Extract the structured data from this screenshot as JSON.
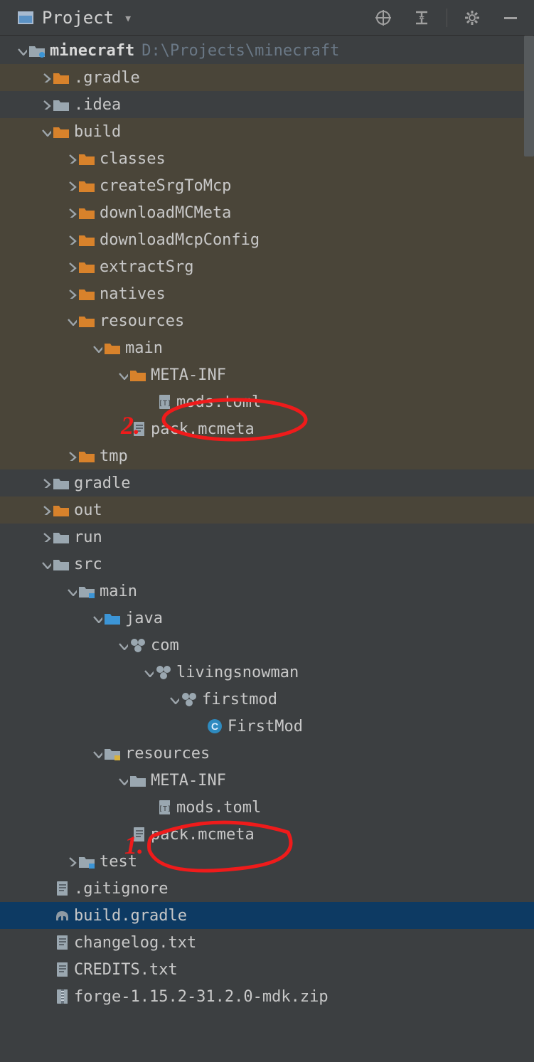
{
  "toolbar": {
    "title": "Project"
  },
  "root": {
    "name": "minecraft",
    "path": "D:\\Projects\\minecraft"
  },
  "rows": [
    {
      "k": "gradleDot",
      "label": ".gradle"
    },
    {
      "k": "ideaDot",
      "label": ".idea"
    },
    {
      "k": "build",
      "label": "build"
    },
    {
      "k": "classes",
      "label": "classes"
    },
    {
      "k": "createSrg",
      "label": "createSrgToMcp"
    },
    {
      "k": "dlMCMeta",
      "label": "downloadMCMeta"
    },
    {
      "k": "dlMcpCfg",
      "label": "downloadMcpConfig"
    },
    {
      "k": "extractSrg",
      "label": "extractSrg"
    },
    {
      "k": "natives",
      "label": "natives"
    },
    {
      "k": "resourcesB",
      "label": "resources"
    },
    {
      "k": "mainB",
      "label": "main"
    },
    {
      "k": "metaInfB",
      "label": "META-INF"
    },
    {
      "k": "modsTomlB",
      "label": "mods.toml"
    },
    {
      "k": "packMcB",
      "label": "pack.mcmeta"
    },
    {
      "k": "tmp",
      "label": "tmp"
    },
    {
      "k": "gradle",
      "label": "gradle"
    },
    {
      "k": "out",
      "label": "out"
    },
    {
      "k": "run",
      "label": "run"
    },
    {
      "k": "src",
      "label": "src"
    },
    {
      "k": "mainS",
      "label": "main"
    },
    {
      "k": "java",
      "label": "java"
    },
    {
      "k": "com",
      "label": "com"
    },
    {
      "k": "livingsnow",
      "label": "livingsnowman"
    },
    {
      "k": "firstmodPkg",
      "label": "firstmod"
    },
    {
      "k": "FirstMod",
      "label": "FirstMod"
    },
    {
      "k": "resourcesS",
      "label": "resources"
    },
    {
      "k": "metaInfS",
      "label": "META-INF"
    },
    {
      "k": "modsTomlS",
      "label": "mods.toml"
    },
    {
      "k": "packMcS",
      "label": "pack.mcmeta"
    },
    {
      "k": "test",
      "label": "test"
    },
    {
      "k": "gitignore",
      "label": ".gitignore"
    },
    {
      "k": "buildGradle",
      "label": "build.gradle"
    },
    {
      "k": "changelog",
      "label": "changelog.txt"
    },
    {
      "k": "credits",
      "label": "CREDITS.txt"
    },
    {
      "k": "forgeZip",
      "label": "forge-1.15.2-31.2.0-mdk.zip"
    }
  ],
  "annotations": {
    "top": "2.",
    "bottom": "1."
  }
}
